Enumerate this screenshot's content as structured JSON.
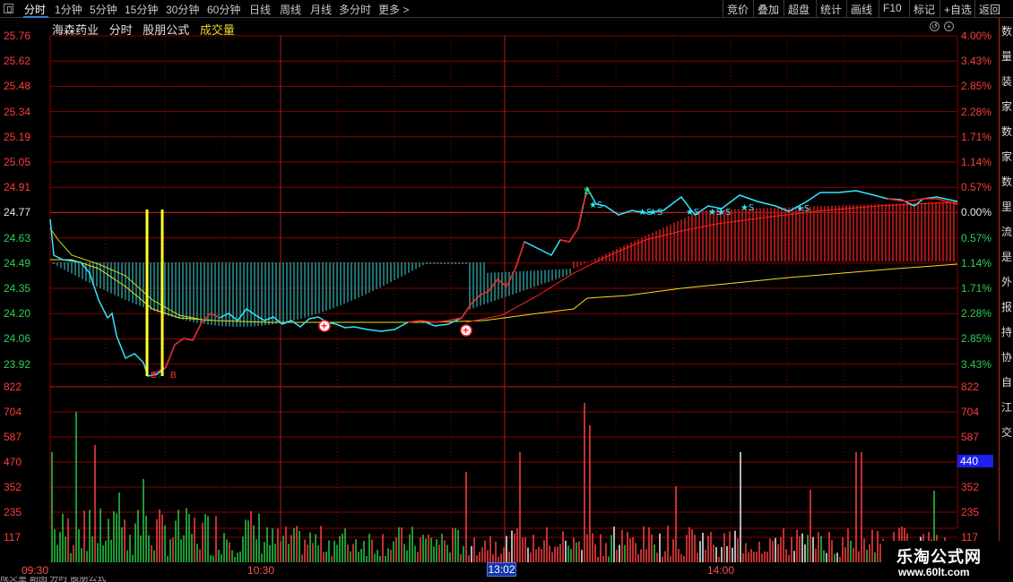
{
  "toolbar": {
    "tabs": [
      "分时",
      "1分钟",
      "5分钟",
      "15分钟",
      "30分钟",
      "60分钟",
      "日线",
      "周线",
      "月线",
      "多分时",
      "更多"
    ],
    "right_buttons": [
      "竞价",
      "叠加",
      "超盘",
      "统计",
      "画线",
      "F10",
      "标记",
      "+自选",
      "返回"
    ]
  },
  "info_bar": {
    "stock_name": "海森药业",
    "period": "分时",
    "formula": "股朋公式",
    "indicator": "成交量"
  },
  "price_axis": {
    "left": [
      "25.76",
      "25.62",
      "25.48",
      "25.34",
      "25.19",
      "25.05",
      "24.91",
      "24.77",
      "24.63",
      "24.49",
      "24.35",
      "24.20",
      "24.06",
      "23.92"
    ],
    "right": [
      "4.00%",
      "3.43%",
      "2.85%",
      "2.28%",
      "1.71%",
      "1.14%",
      "0.57%",
      "0.00%",
      "0.57%",
      "1.14%",
      "1.71%",
      "2.28%",
      "2.85%",
      "3.43%"
    ]
  },
  "volume_axis": {
    "left": [
      "822",
      "704",
      "587",
      "470",
      "352",
      "235",
      "117"
    ],
    "right": [
      "822",
      "704",
      "587",
      "470",
      "352",
      "235",
      "117"
    ],
    "highlight": "440"
  },
  "time_axis": {
    "labels": [
      "09:30",
      "10:30",
      "14:00"
    ],
    "cursor": "13:02"
  },
  "markers": {
    "buy_text": "B",
    "sell_text": "S",
    "plus": "+"
  },
  "colors": {
    "up": "#ff3b3b",
    "down": "#2ccf55",
    "price_line": "#33e6ff",
    "avg_line": "#f0e020",
    "grid": "#8b0000",
    "accent": "#1f1ff0"
  },
  "right_strip": [
    "数",
    "量",
    "装",
    "家",
    "数",
    "家",
    "数",
    "里",
    "流",
    "是",
    "外",
    "报",
    "持",
    "协",
    "自",
    "江",
    "交"
  ],
  "watermark": {
    "title": "乐淘公式网",
    "url": "www.60lt.com"
  },
  "status": "成交量 副图 分时 股朋公式"
}
